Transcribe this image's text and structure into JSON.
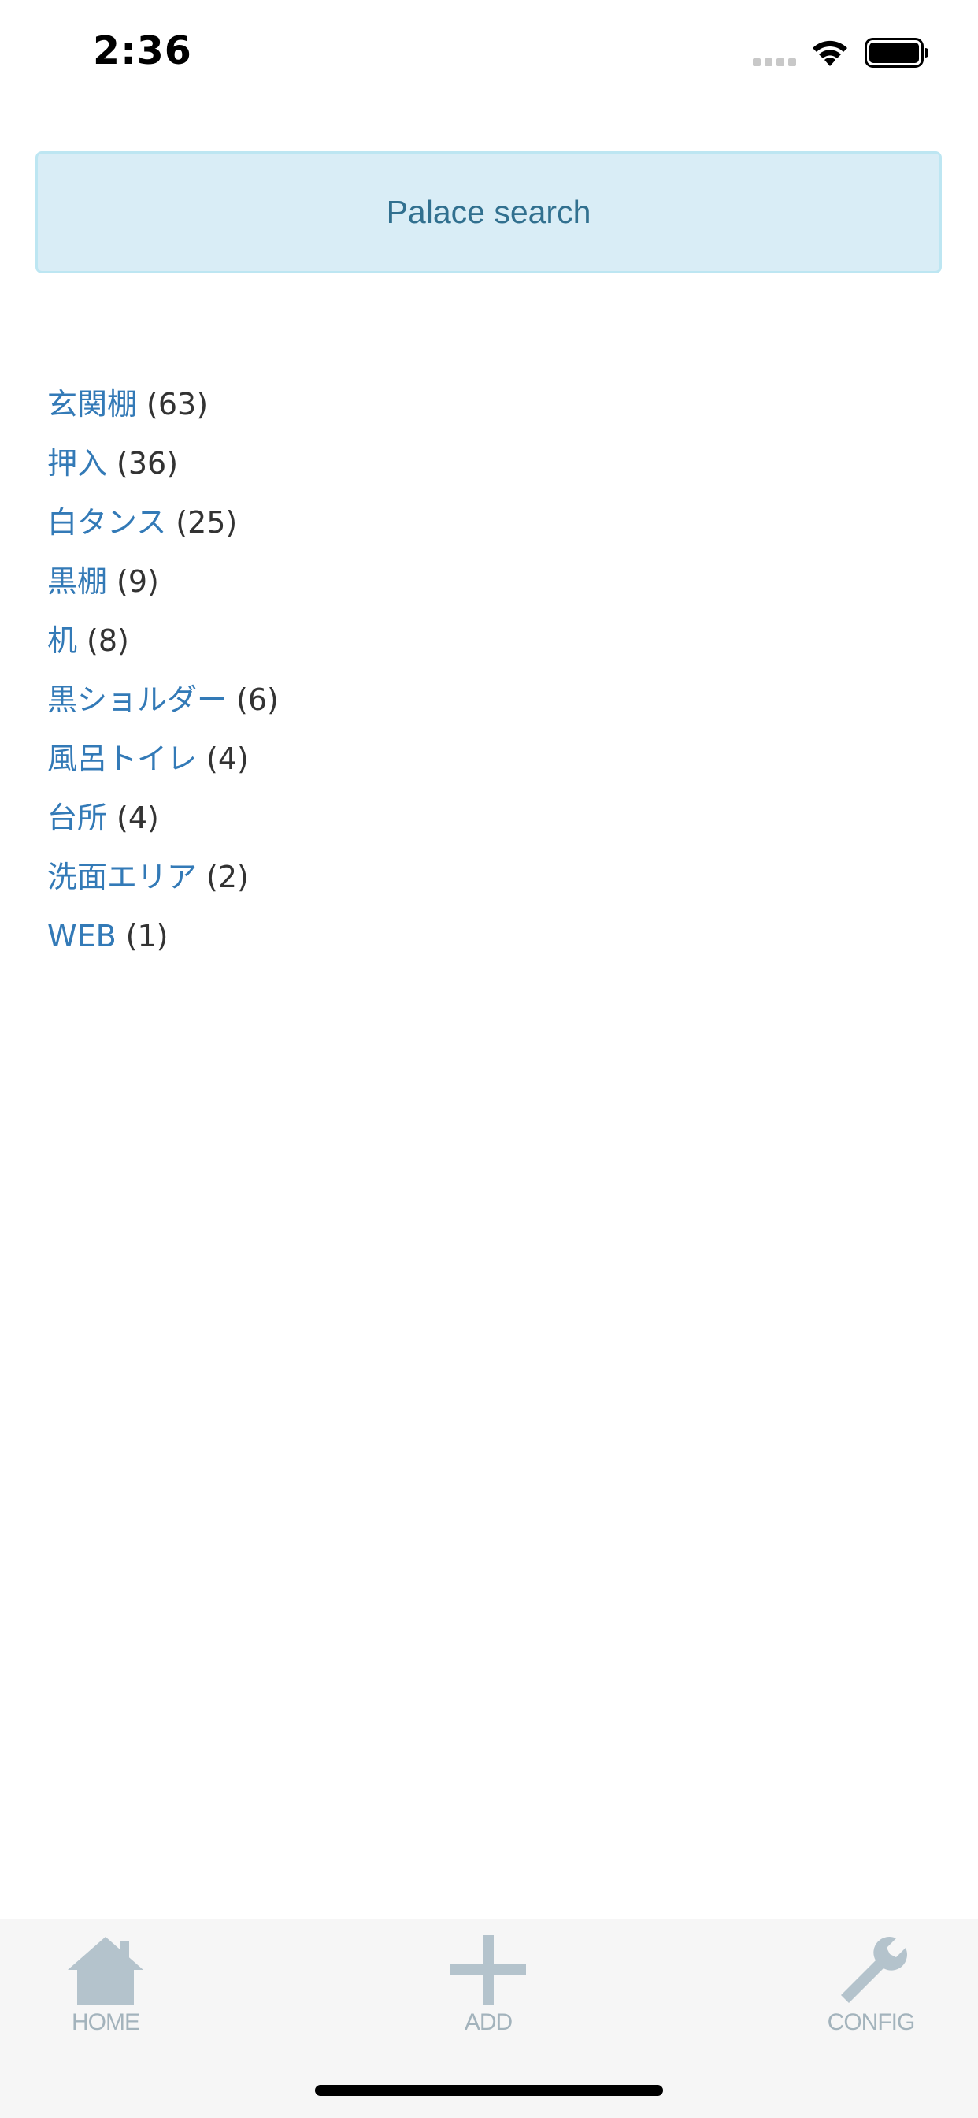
{
  "status_bar": {
    "time": "2:36",
    "icons": [
      "signal-dots-icon",
      "wifi-icon",
      "battery-icon"
    ]
  },
  "search": {
    "button_label": "Palace search"
  },
  "places": [
    {
      "name": "玄関棚",
      "count": "(63)"
    },
    {
      "name": "押入",
      "count": "(36)"
    },
    {
      "name": "白タンス",
      "count": "(25)"
    },
    {
      "name": "黒棚",
      "count": "(9)"
    },
    {
      "name": "机",
      "count": "(8)"
    },
    {
      "name": "黒ショルダー",
      "count": "(6)"
    },
    {
      "name": "風呂トイレ",
      "count": "(4)"
    },
    {
      "name": "台所",
      "count": "(4)"
    },
    {
      "name": "洗面エリア",
      "count": "(2)"
    },
    {
      "name": "WEB",
      "count": "(1)"
    }
  ],
  "tab_bar": {
    "tabs": [
      {
        "label": "HOME",
        "icon": "home-icon"
      },
      {
        "label": "ADD",
        "icon": "plus-icon"
      },
      {
        "label": "CONFIG",
        "icon": "wrench-icon"
      }
    ]
  },
  "colors": {
    "link": "#337ab7",
    "count_text": "#333333",
    "search_bg": "#d9edf6",
    "search_border": "#bde6f2",
    "search_text": "#31708f",
    "tab_icon": "#a3b3bc",
    "tab_bar_bg": "#f6f6f6"
  }
}
